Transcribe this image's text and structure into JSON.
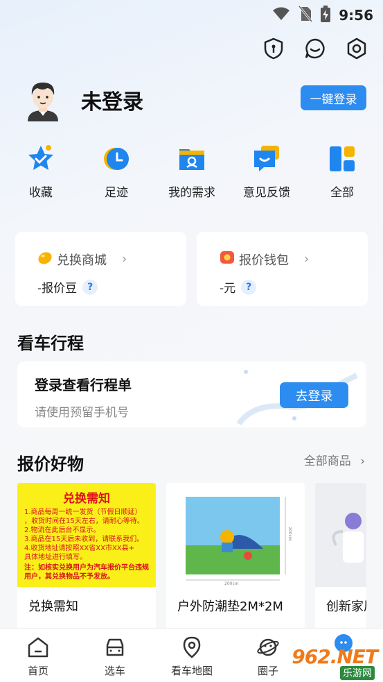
{
  "status_bar": {
    "time": "9:56"
  },
  "profile": {
    "name": "未登录",
    "login_button": "一键登录"
  },
  "quick_nav": [
    {
      "label": "收藏",
      "icon": "star-icon"
    },
    {
      "label": "足迹",
      "icon": "clock-icon"
    },
    {
      "label": "我的需求",
      "icon": "folder-icon"
    },
    {
      "label": "意见反馈",
      "icon": "chat-icon"
    },
    {
      "label": "全部",
      "icon": "grid-icon"
    }
  ],
  "cards": {
    "mall": {
      "title": "兑换商城",
      "value": "-报价豆",
      "help": "?"
    },
    "wallet": {
      "title": "报价钱包",
      "value": "-元",
      "help": "?"
    }
  },
  "trip": {
    "section_title": "看车行程",
    "title": "登录查看行程单",
    "subtitle": "请使用预留手机号",
    "button": "去登录"
  },
  "goods": {
    "section_title": "报价好物",
    "all_link": "全部商品",
    "notice": {
      "title": "兑换需知",
      "lines": [
        "1.商品每周一统一发货（节假日顺延）",
        "，收货时间在15天左右，请耐心等待。",
        "2.物流在此后台不显示。",
        "3.商品在15天后未收到，请联系我们。",
        "4.收货地址请按照XX省XX市XX县+",
        "具体地址进行填写。"
      ],
      "note": "注：如核实兑换用户为汽车报价平台违规用户，其兑换物品不予发放。"
    },
    "items": [
      {
        "name": "兑换需知"
      },
      {
        "name": "户外防潮垫2M*2M",
        "dim_h": "200cm",
        "dim_w": "200cm"
      },
      {
        "name": "创新家居"
      }
    ]
  },
  "bottom_nav": [
    {
      "label": "首页",
      "icon": "home-icon"
    },
    {
      "label": "选车",
      "icon": "car-icon"
    },
    {
      "label": "看车地图",
      "icon": "map-pin-icon"
    },
    {
      "label": "圈子",
      "icon": "planet-icon"
    }
  ],
  "watermark": {
    "text": "962.NET",
    "subtext": "乐游网"
  },
  "colors": {
    "accent": "#2d8cf0",
    "background": "#f6f7f9"
  }
}
